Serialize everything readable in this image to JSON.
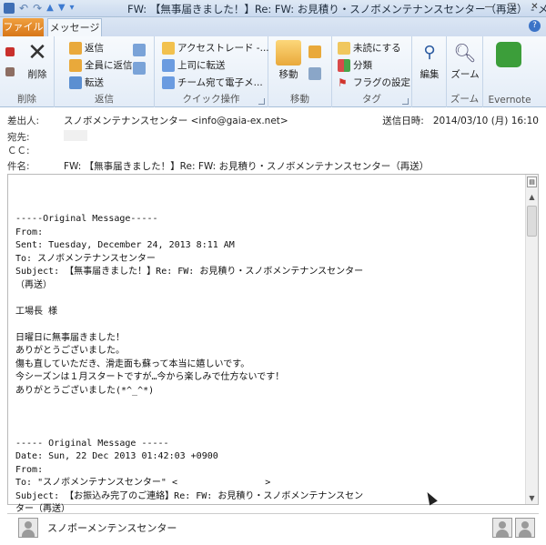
{
  "window": {
    "title": "FW: 【無事届きました！】Re: FW: お見積り・スノボメンテナンスセンター（再送） - メ...",
    "controls": [
      "—",
      "□",
      "✕"
    ]
  },
  "tabs": {
    "file": "ファイル",
    "message": "メッセージ",
    "help": "?"
  },
  "ribbon": {
    "delete_group": {
      "label": "削除",
      "delete_button": "削除"
    },
    "reply_group": {
      "label": "返信",
      "reply": "返信",
      "reply_all": "全員に返信",
      "forward": "転送"
    },
    "quickstep_group": {
      "label": "クイック操作",
      "items": [
        "アクセストレード -...",
        "上司に転送",
        "チーム宛て電子メ..."
      ]
    },
    "move_group": {
      "label": "移動",
      "move": "移動"
    },
    "tags_group": {
      "label": "タグ",
      "unread": "未読にする",
      "categorize": "分類",
      "followup": "フラグの設定"
    },
    "edit_group": {
      "label": "",
      "edit": "編集"
    },
    "zoom_group": {
      "label": "ズーム",
      "zoom": "ズーム"
    },
    "evernote_group": {
      "label": "Evernote"
    }
  },
  "header": {
    "from_label": "差出人:",
    "from_value": "スノボメンテナンスセンター <info@gaia-ex.net>",
    "to_label": "宛先:",
    "cc_label": "ＣＣ:",
    "subject_label": "件名:",
    "subject_value": "FW: 【無事届きました！】Re: FW: お見積り・スノボメンテナンスセンター（再送）",
    "sent_label": "送信日時:",
    "sent_value": "2014/03/10 (月) 16:10"
  },
  "body": {
    "lines": [
      "-----Original Message-----",
      "From:",
      "Sent: Tuesday, December 24, 2013 8:11 AM",
      "To: スノボメンテナンスセンター",
      "Subject: 【無事届きました！】Re: FW: お見積り・スノボメンテナンスセンター",
      "（再送）",
      "",
      "工場長 様",
      "",
      "日曜日に無事届きました！",
      "ありがとうございました。",
      "傷も直していただき、滑走面も蘇って本当に嬉しいです。",
      "今シーズンは１月スタートですが…今から楽しみで仕方ないです！",
      "ありがとうございました(*^_^*)",
      "",
      "",
      "",
      "----- Original Message -----",
      "Date: Sun, 22 Dec 2013 01:42:03 +0900",
      "From:",
      "To: \"スノボメンテナンスセンター\" <                >",
      "Subject: 【お振込み完了のご連絡】Re: FW: お見積り・スノボメンテナンスセン",
      "ター（再送）"
    ]
  },
  "people_pane": {
    "name": "スノボーメンテンスセンター"
  }
}
